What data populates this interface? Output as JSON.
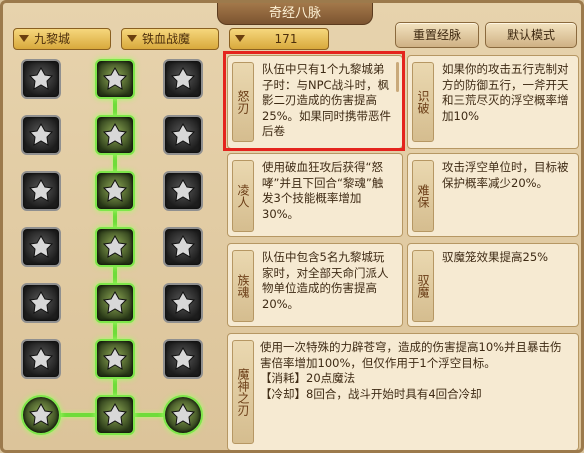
{
  "title": "奇经八脉",
  "dropdowns": {
    "school": "九黎城",
    "style": "铁血战魔",
    "level": "171"
  },
  "buttons": {
    "reset": "重置经脉",
    "default": "默认模式"
  },
  "colors": {
    "active_path": "#6fdc3a",
    "highlight_border": "#e4241d",
    "panel_bg": "#f6ead2"
  },
  "nodes": {
    "col1": [
      "talent-icon",
      "talent-icon",
      "talent-icon",
      "talent-icon",
      "talent-icon",
      "talent-icon",
      "talent-icon"
    ],
    "col2": [
      "talent-icon",
      "talent-icon",
      "talent-icon",
      "talent-icon",
      "talent-icon",
      "talent-icon",
      "talent-icon"
    ],
    "col3": [
      "talent-icon",
      "talent-icon",
      "talent-icon",
      "talent-icon",
      "talent-icon",
      "talent-icon",
      "talent-icon"
    ]
  },
  "skills": [
    {
      "name": "怒刃",
      "desc": "队伍中只有1个九黎城弟子时：与NPC战斗时，枫影二刃造成的伤害提高25%。如果同时携带恶件后卷"
    },
    {
      "name": "识破",
      "desc": "如果你的攻击五行克制对方的防御五行，一斧开天和三荒尽灭的浮空概率增加10%"
    },
    {
      "name": "凌人",
      "desc": "使用破血狂攻后获得“怒哮”并且下回合“黎魂”触发3个技能概率增加30%。"
    },
    {
      "name": "难保",
      "desc": "攻击浮空单位时，目标被保护概率减少20%。"
    },
    {
      "name": "族魂",
      "desc": "队伍中包含5名九黎城玩家时，对全部天命门派人物单位造成的伤害提高20%。"
    },
    {
      "name": "驭魔",
      "desc": "驭魔笼效果提高25%"
    }
  ],
  "big_skill": {
    "name": "魔神之刃",
    "lines": [
      "使用一次特殊的力辟苍穹，造成的伤害提高10%并且暴击伤害倍率增加100%，但仅作用于1个浮空目标。",
      "【消耗】20点魔法",
      "【冷却】8回合，战斗开始时具有4回合冷却"
    ]
  }
}
